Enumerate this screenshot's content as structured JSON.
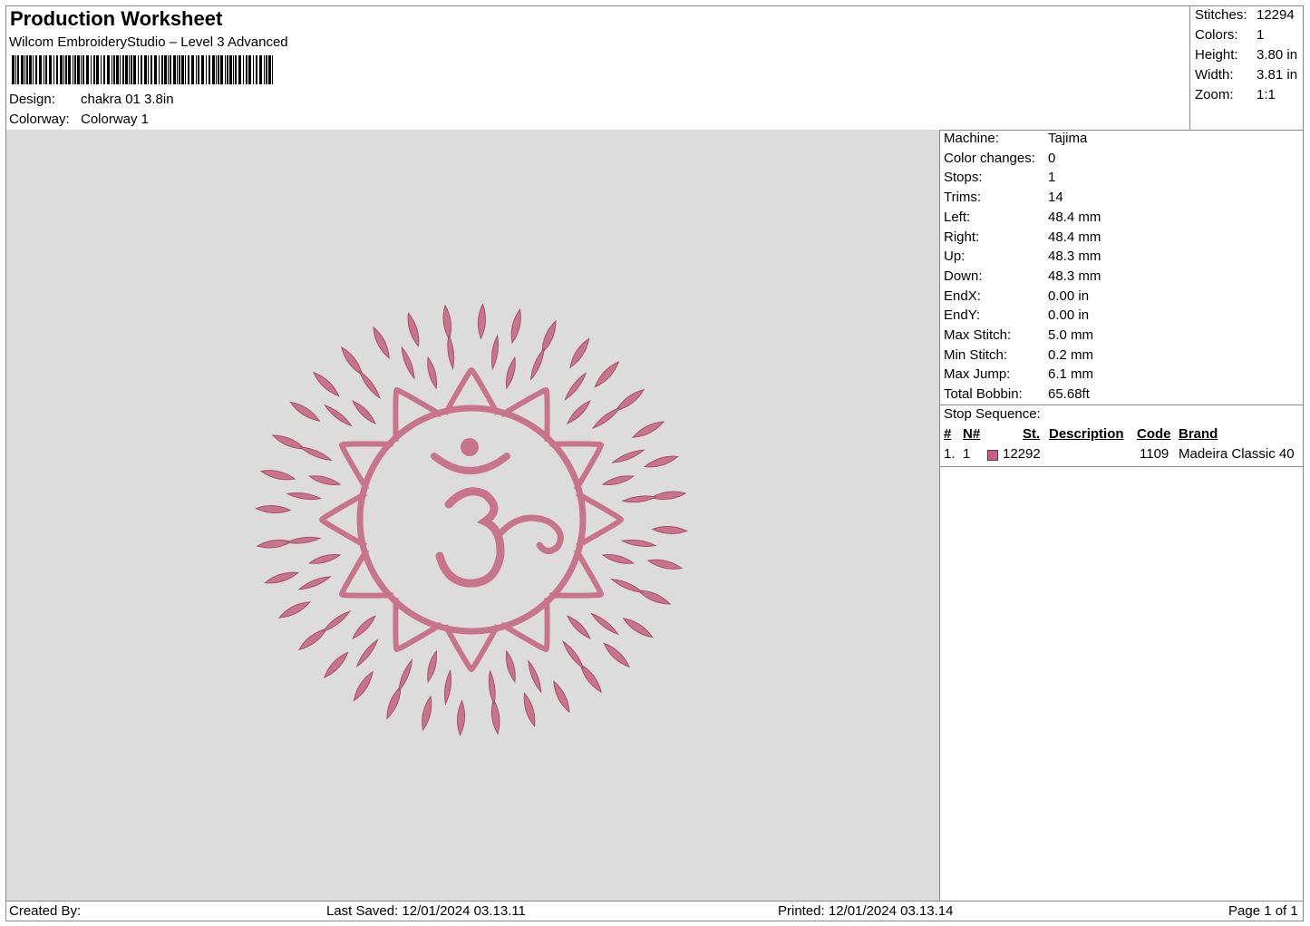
{
  "header": {
    "title": "Production Worksheet",
    "subtitle": "Wilcom EmbroideryStudio – Level 3 Advanced",
    "design_label": "Design:",
    "design_value": "chakra 01 3.8in",
    "colorway_label": "Colorway:",
    "colorway_value": "Colorway 1"
  },
  "summary": {
    "stitches_label": "Stitches:",
    "stitches_value": "12294",
    "colors_label": "Colors:",
    "colors_value": "1",
    "height_label": "Height:",
    "height_value": "3.80 in",
    "width_label": "Width:",
    "width_value": "3.81 in",
    "zoom_label": "Zoom:",
    "zoom_value": "1:1"
  },
  "machine_info": [
    {
      "label": "Machine:",
      "value": "Tajima"
    },
    {
      "label": "Color changes:",
      "value": "0"
    },
    {
      "label": "Stops:",
      "value": "1"
    },
    {
      "label": "Trims:",
      "value": "14"
    },
    {
      "label": "Left:",
      "value": "48.4 mm"
    },
    {
      "label": "Right:",
      "value": "48.4 mm"
    },
    {
      "label": "Up:",
      "value": "48.3 mm"
    },
    {
      "label": "Down:",
      "value": "48.3 mm"
    },
    {
      "label": "EndX:",
      "value": "0.00 in"
    },
    {
      "label": "EndY:",
      "value": "0.00 in"
    },
    {
      "label": "Max Stitch:",
      "value": "5.0 mm"
    },
    {
      "label": "Min Stitch:",
      "value": "0.2 mm"
    },
    {
      "label": "Max Jump:",
      "value": "6.1 mm"
    },
    {
      "label": "Total Bobbin:",
      "value": "65.68ft"
    }
  ],
  "stop_sequence": {
    "title": "Stop Sequence:",
    "headers": {
      "num": "#",
      "n": "N#",
      "st": "St.",
      "description": "Description",
      "code": "Code",
      "brand": "Brand"
    },
    "rows": [
      {
        "num": "1.",
        "n": "1",
        "swatch_color": "#d05b8a",
        "st": "12292",
        "description": "",
        "code": "1109",
        "brand": "Madeira Classic 40"
      }
    ]
  },
  "design_preview": {
    "thread_color": "#c8748c",
    "background": "#dcdcdc",
    "motif": "om-lotus-chakra"
  },
  "footer": {
    "created_by": "Created By:",
    "last_saved": "Last Saved: 12/01/2024 03.13.11",
    "printed": "Printed: 12/01/2024 03.13.14",
    "page": "Page 1 of 1"
  }
}
